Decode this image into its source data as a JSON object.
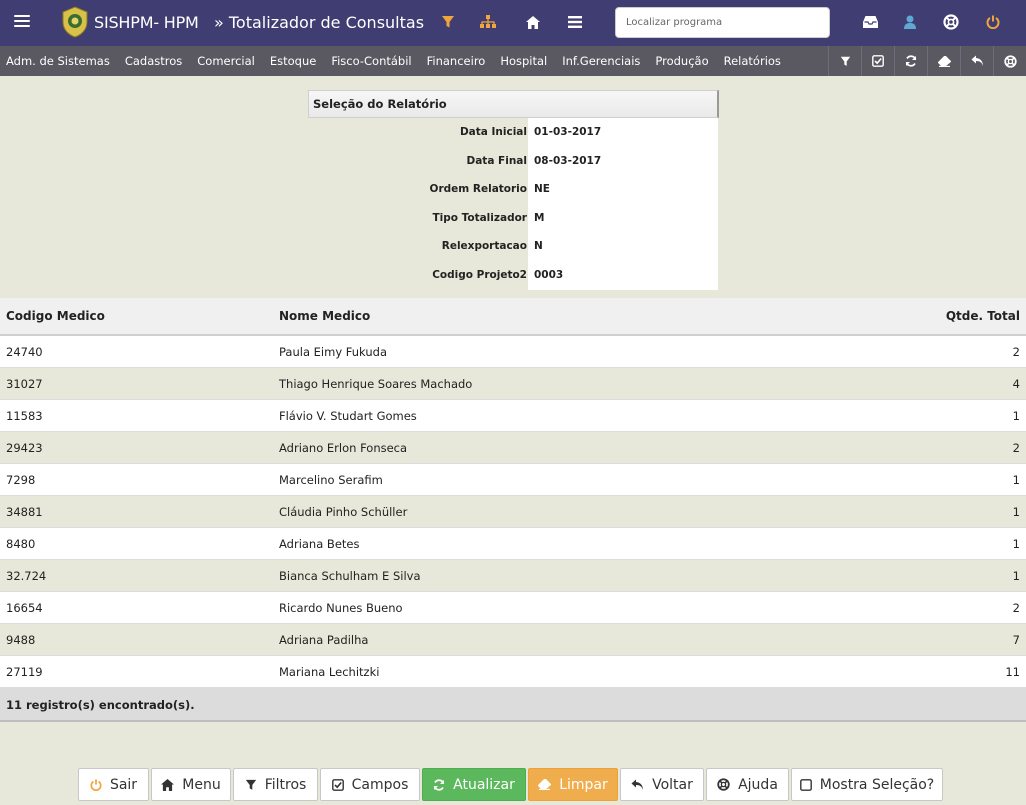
{
  "header": {
    "app_title": "SISHPM- HPM",
    "page_title": "» Totalizador de Consultas",
    "search_placeholder": "Localizar programa",
    "icons": [
      "menu-icon",
      "filter-icon",
      "sitemap-icon",
      "home-icon",
      "list-icon",
      "inbox-icon",
      "user-icon",
      "lifebuoy-icon",
      "power-icon"
    ]
  },
  "menubar": {
    "items": [
      "Adm. de Sistemas",
      "Cadastros",
      "Comercial",
      "Estoque",
      "Fisco-Contábil",
      "Financeiro",
      "Hospital",
      "Inf.Gerenciais",
      "Produção",
      "Relatórios"
    ],
    "tools": [
      "filter-icon",
      "checkbox-icon",
      "refresh-icon",
      "eraser-icon",
      "undo-icon",
      "lifebuoy-icon"
    ]
  },
  "selection": {
    "title": "Seleção do Relatório",
    "rows": [
      {
        "label": "Data Inicial",
        "value": "01-03-2017"
      },
      {
        "label": "Data Final",
        "value": "08-03-2017"
      },
      {
        "label": "Ordem Relatorio",
        "value": "NE"
      },
      {
        "label": "Tipo Totalizador",
        "value": "M"
      },
      {
        "label": "Relexportacao",
        "value": "N"
      },
      {
        "label": "Codigo Projeto2",
        "value": "0003"
      }
    ]
  },
  "table": {
    "headers": [
      "Codigo Medico",
      "Nome Medico",
      "Qtde. Total"
    ],
    "rows": [
      [
        "24740",
        "Paula Eimy Fukuda",
        "2"
      ],
      [
        "31027",
        "Thiago Henrique Soares Machado",
        "4"
      ],
      [
        "11583",
        "Flávio V. Studart Gomes",
        "1"
      ],
      [
        "29423",
        "Adriano Erlon Fonseca",
        "2"
      ],
      [
        "7298",
        "Marcelino Serafim",
        "1"
      ],
      [
        "34881",
        "Cláudia Pinho Schüller",
        "1"
      ],
      [
        "8480",
        "Adriana Betes",
        "1"
      ],
      [
        "32.724",
        "Bianca Schulham E Silva",
        "1"
      ],
      [
        "16654",
        "Ricardo Nunes Bueno",
        "2"
      ],
      [
        "9488",
        "Adriana Padilha",
        "7"
      ],
      [
        "27119",
        "Mariana Lechitzki",
        "11"
      ]
    ],
    "footer": "11 registro(s) encontrado(s)."
  },
  "buttons": {
    "sair": "Sair",
    "menu": "Menu",
    "filtros": "Filtros",
    "campos": "Campos",
    "atualizar": "Atualizar",
    "limpar": "Limpar",
    "voltar": "Voltar",
    "ajuda": "Ajuda",
    "mostra": "Mostra Seleção?"
  },
  "colors": {
    "header_bg": "#3f3d72",
    "menubar_bg": "#5a5860",
    "icon_orange": "#f0a63c",
    "user_blue": "#5fa8d3",
    "btn_green": "#5cb85c",
    "btn_orange": "#f0ad4e"
  }
}
